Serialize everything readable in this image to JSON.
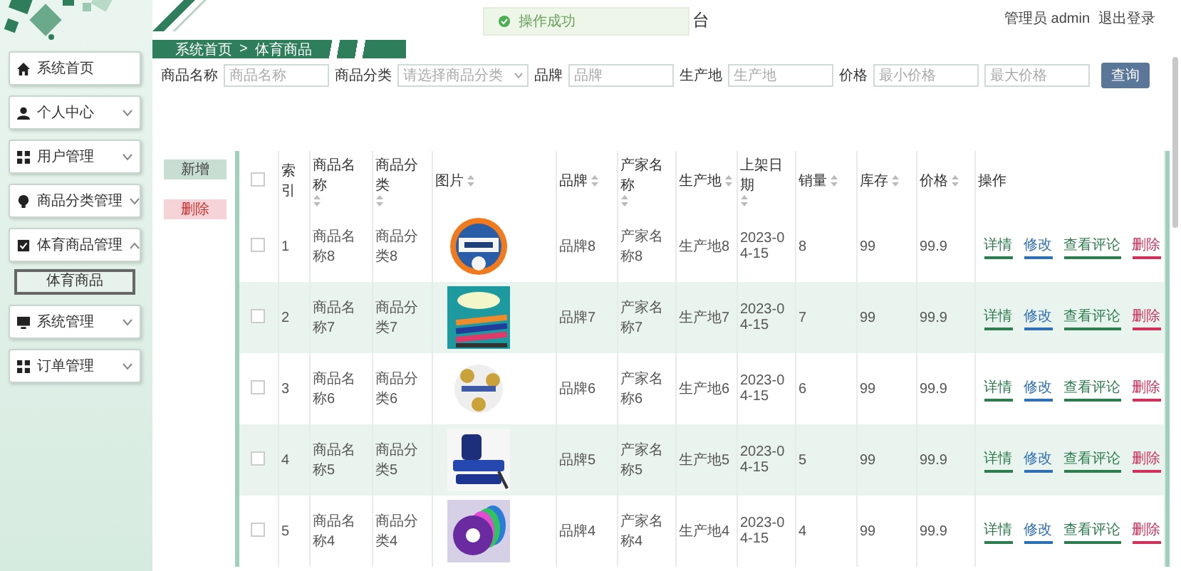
{
  "sidebar": {
    "items": [
      {
        "label": "系统首页"
      },
      {
        "label": "个人中心",
        "expanded": false
      },
      {
        "label": "用户管理",
        "expanded": false
      },
      {
        "label": "商品分类管理",
        "expanded": false
      },
      {
        "label": "体育商品管理",
        "expanded": true,
        "children": [
          {
            "label": "体育商品",
            "selected": true
          }
        ]
      },
      {
        "label": "系统管理",
        "expanded": false
      },
      {
        "label": "订单管理",
        "expanded": false
      }
    ]
  },
  "header": {
    "title": "台",
    "user": "管理员 admin",
    "logout": "退出登录"
  },
  "toast": {
    "kind": "success",
    "text": "操作成功"
  },
  "breadcrumb": {
    "items": [
      "系统首页",
      "体育商品"
    ],
    "separator": ">"
  },
  "search": {
    "fields": [
      {
        "label": "商品名称",
        "placeholder": "商品名称",
        "kind": "input"
      },
      {
        "label": "商品分类",
        "placeholder": "请选择商品分类",
        "kind": "select"
      },
      {
        "label": "品牌",
        "placeholder": "品牌",
        "kind": "input"
      },
      {
        "label": "生产地",
        "placeholder": "生产地",
        "kind": "input"
      },
      {
        "label": "价格",
        "placeholder": "最小价格",
        "kind": "input"
      },
      {
        "placeholder": "最大价格",
        "kind": "input"
      }
    ],
    "button": "查询"
  },
  "actions": [
    {
      "label": "新增",
      "kind": "add"
    },
    {
      "label": "删除",
      "kind": "delete"
    }
  ],
  "table": {
    "select_all": {
      "checked": false
    },
    "columns": [
      "索引",
      "商品名称",
      "商品分类",
      "图片",
      "品牌",
      "产家名称",
      "生产地",
      "上架日期",
      "销量",
      "库存",
      "价格",
      "操作"
    ],
    "rows": [
      {
        "checked": false,
        "cells": [
          "1",
          "商品名称8",
          "商品分类8",
          {
            "kind": "picture"
          },
          "品牌8",
          "产家名称8",
          "生产地8",
          "2023-04-15",
          "8",
          "99",
          "99.9"
        ],
        "actions": [
          {
            "label": "详情",
            "kind": "detail"
          },
          {
            "label": "修改",
            "kind": "edit"
          },
          {
            "label": "查看评论",
            "kind": "review"
          },
          {
            "label": "删除",
            "kind": "delete"
          }
        ]
      },
      {
        "checked": false,
        "cells": [
          "2",
          "商品名称7",
          "商品分类7",
          {
            "kind": "picture"
          },
          "品牌7",
          "产家名称7",
          "生产地7",
          "2023-04-15",
          "7",
          "99",
          "99.9"
        ],
        "actions": [
          {
            "label": "详情",
            "kind": "detail"
          },
          {
            "label": "修改",
            "kind": "edit"
          },
          {
            "label": "查看评论",
            "kind": "review"
          },
          {
            "label": "删除",
            "kind": "delete"
          }
        ]
      },
      {
        "checked": false,
        "cells": [
          "3",
          "商品名称6",
          "商品分类6",
          {
            "kind": "picture"
          },
          "品牌6",
          "产家名称6",
          "生产地6",
          "2023-04-15",
          "6",
          "99",
          "99.9"
        ],
        "actions": [
          {
            "label": "详情",
            "kind": "detail"
          },
          {
            "label": "修改",
            "kind": "edit"
          },
          {
            "label": "查看评论",
            "kind": "review"
          },
          {
            "label": "删除",
            "kind": "delete"
          }
        ]
      },
      {
        "checked": false,
        "cells": [
          "4",
          "商品名称5",
          "商品分类5",
          {
            "kind": "picture"
          },
          "品牌5",
          "产家名称5",
          "生产地5",
          "2023-04-15",
          "5",
          "99",
          "99.9"
        ],
        "actions": [
          {
            "label": "详情",
            "kind": "detail"
          },
          {
            "label": "修改",
            "kind": "edit"
          },
          {
            "label": "查看评论",
            "kind": "review"
          },
          {
            "label": "删除",
            "kind": "delete"
          }
        ]
      },
      {
        "checked": false,
        "cells": [
          "5",
          "商品名称4",
          "商品分类4",
          {
            "kind": "picture"
          },
          "品牌4",
          "产家名称4",
          "生产地4",
          "2023-04-15",
          "4",
          "99",
          "99.9"
        ],
        "actions": [
          {
            "label": "详情",
            "kind": "detail"
          },
          {
            "label": "修改",
            "kind": "edit"
          },
          {
            "label": "查看评论",
            "kind": "review"
          },
          {
            "label": "删除",
            "kind": "delete"
          }
        ]
      }
    ]
  }
}
